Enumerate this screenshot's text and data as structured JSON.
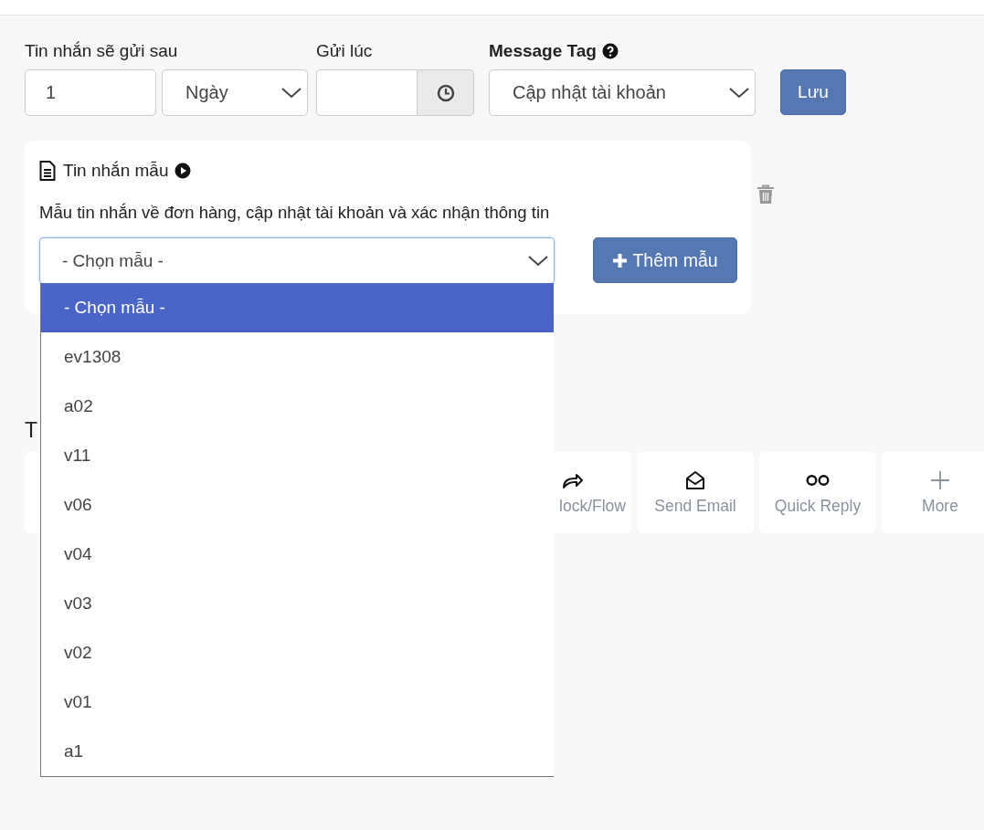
{
  "schedule": {
    "delay_label": "Tin nhắn sẽ gửi sau",
    "delay_value": "1",
    "unit_value": "Ngày",
    "time_label": "Gửi lúc",
    "tag_label": "Message Tag",
    "tag_value": "Cập nhật tài khoản",
    "save_button": "Lưu"
  },
  "template_card": {
    "title": "Tin nhắn mẫu",
    "description": "Mẫu tin nhắn về đơn hàng, cập nhật tài khoản và xác nhận thông tin",
    "select_value": "- Chọn mẫu -",
    "add_button": "Thêm mẫu",
    "options": [
      {
        "label": "- Chọn mẫu -",
        "selected": true
      },
      {
        "label": "ev1308",
        "selected": false
      },
      {
        "label": "a02",
        "selected": false
      },
      {
        "label": "v11",
        "selected": false
      },
      {
        "label": "v06",
        "selected": false
      },
      {
        "label": "v04",
        "selected": false
      },
      {
        "label": "v03",
        "selected": false
      },
      {
        "label": "v02",
        "selected": false
      },
      {
        "label": "v01",
        "selected": false
      },
      {
        "label": "a1",
        "selected": false
      }
    ]
  },
  "section_heading": "T",
  "actions": [
    {
      "kind": "share",
      "label": "lock/Flow"
    },
    {
      "kind": "email",
      "label": "Send Email"
    },
    {
      "kind": "quick-reply",
      "label": "Quick Reply"
    },
    {
      "kind": "more",
      "label": "More"
    }
  ]
}
